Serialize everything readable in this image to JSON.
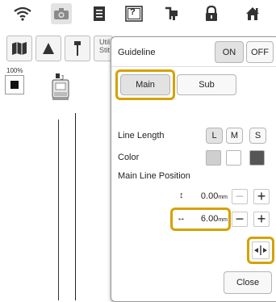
{
  "top_bar": {
    "icons": [
      "wifi-icon",
      "camera-icon",
      "document-icon",
      "help-icon",
      "thread-icon",
      "lock-icon",
      "home-icon"
    ],
    "help_label": "?"
  },
  "left_panel": {
    "util_text_line1": "Util",
    "util_text_line2": "Stit",
    "zoom_label": "100%"
  },
  "guideline_panel": {
    "title": "Guideline",
    "on_label": "ON",
    "off_label": "OFF",
    "tabs": {
      "main": "Main",
      "sub": "Sub"
    },
    "line_length": {
      "label": "Line Length",
      "options": [
        "L",
        "M",
        "S"
      ]
    },
    "color": {
      "label": "Color",
      "swatches": [
        "#cfcfcf",
        "#ffffff",
        "#555555"
      ]
    },
    "main_line_position": {
      "label": "Main Line Position",
      "vertical": {
        "value": "0.00",
        "unit": "mm"
      },
      "horizontal": {
        "value": "6.00",
        "unit": "mm"
      }
    },
    "close_label": "Close"
  },
  "colors": {
    "highlight": "#d6a100",
    "panel_border": "#999999"
  }
}
